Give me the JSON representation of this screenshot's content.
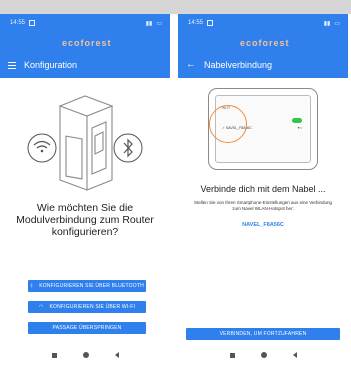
{
  "left_screen": {
    "status_time": "14:55",
    "logo_text": "ecoforest",
    "title": "Konfiguration",
    "question": "Wie möchten Sie die Modulverbindung zum Router konfigurieren?",
    "buttons": {
      "bluetooth": "KONFIGURIEREN SIE ÜBER BLUETOOTH",
      "wifi": "KONFIGURIEREN SIE ÜBER WI-FI",
      "skip": "PASSAGE ÜBERSPRINGEN"
    }
  },
  "right_screen": {
    "status_time": "14:55",
    "logo_text": "ecoforest",
    "title": "Nabelverbindung",
    "wifi_label": "Wi-Fi",
    "network_item": "NAVEL_F8A56C",
    "heading": "Verbinde dich mit dem Nabel ...",
    "instructions": "Stellen Sie von Ihren Smartphone-Einstellungen aus eine Verbindung zum Navel WLAN-Hotspot her:",
    "ssid": "NAVEL_F8A56C",
    "continue_button": "VERBINDEN, UM FORTZUFAHREN"
  },
  "colors": {
    "primary": "#2f80ed",
    "logo": "#f3c0a0",
    "toggle_green": "#33c64a",
    "highlight_orange": "#f08a3c"
  }
}
